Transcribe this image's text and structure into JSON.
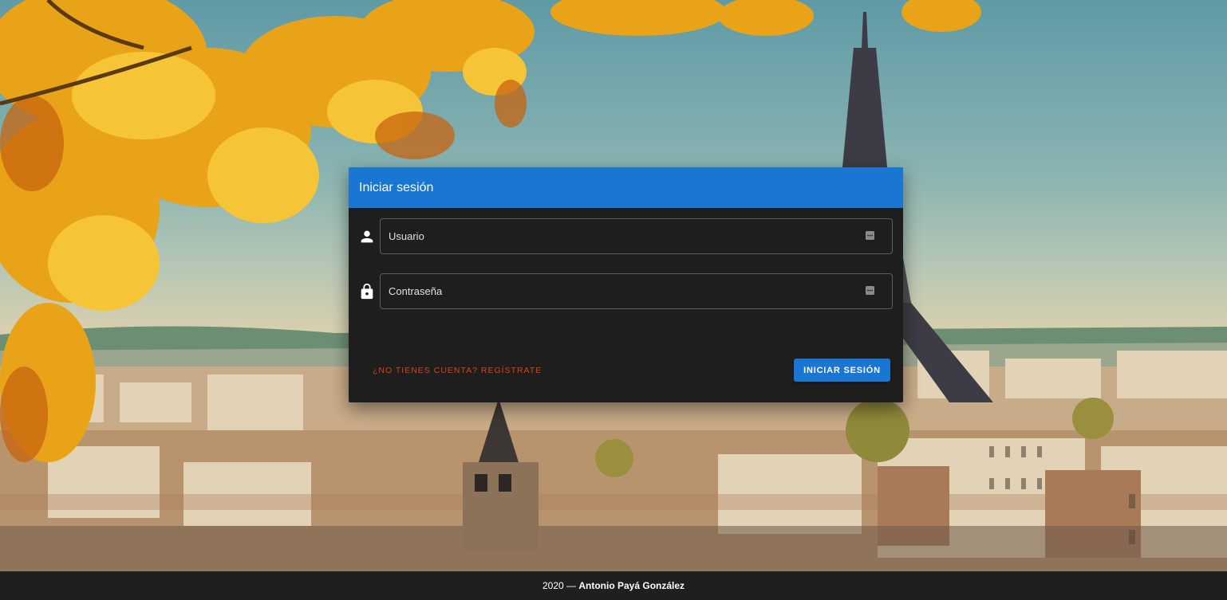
{
  "login": {
    "title": "Iniciar sesión",
    "username": {
      "placeholder": "Usuario",
      "value": "",
      "icon": "account-icon"
    },
    "password": {
      "placeholder": "Contraseña",
      "value": "",
      "icon": "lock-icon"
    },
    "register_label": "¿No tienes cuenta? Regístrate",
    "submit_label": "Iniciar sesión"
  },
  "footer": {
    "year": "2020",
    "separator": " — ",
    "author": "Antonio Payá González"
  },
  "colors": {
    "primary": "#1976d2",
    "card_background": "#1e1e1e",
    "link": "#d84315",
    "footer_background": "#1f1f1f"
  }
}
